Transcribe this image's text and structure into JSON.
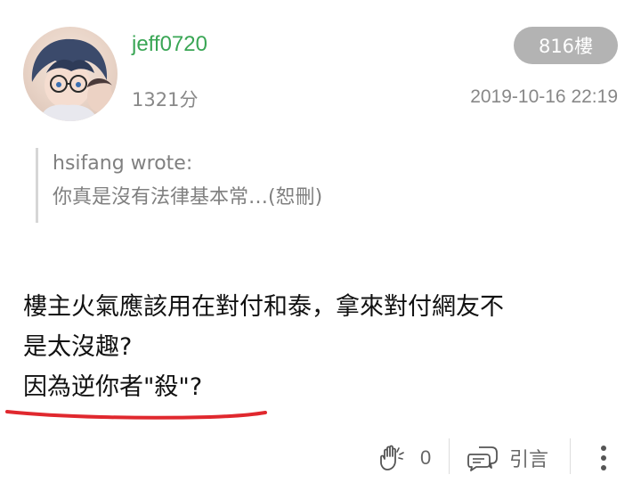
{
  "post": {
    "username": "jeff0720",
    "score": "1321分",
    "floor": "816樓",
    "timestamp": "2019-10-16 22:19",
    "quote": {
      "author": "hsifang wrote:",
      "text": "你真是沒有法律基本常…(恕刪)"
    },
    "body": {
      "line1": "樓主火氣應該用在對付和泰，拿來對付網友不",
      "line2": "是太沒趣?",
      "line3": "因為逆你者\"殺\"?"
    }
  },
  "actions": {
    "like_count": "0",
    "quote_label": "引言"
  },
  "icons": {
    "like": "clap-hands-icon",
    "quote": "speech-bubble-icon",
    "more": "vertical-dots-icon"
  },
  "colors": {
    "username": "#3aa655",
    "badge_bg": "#b3b3b3",
    "underline": "#e0282e",
    "muted_text": "#888888"
  }
}
